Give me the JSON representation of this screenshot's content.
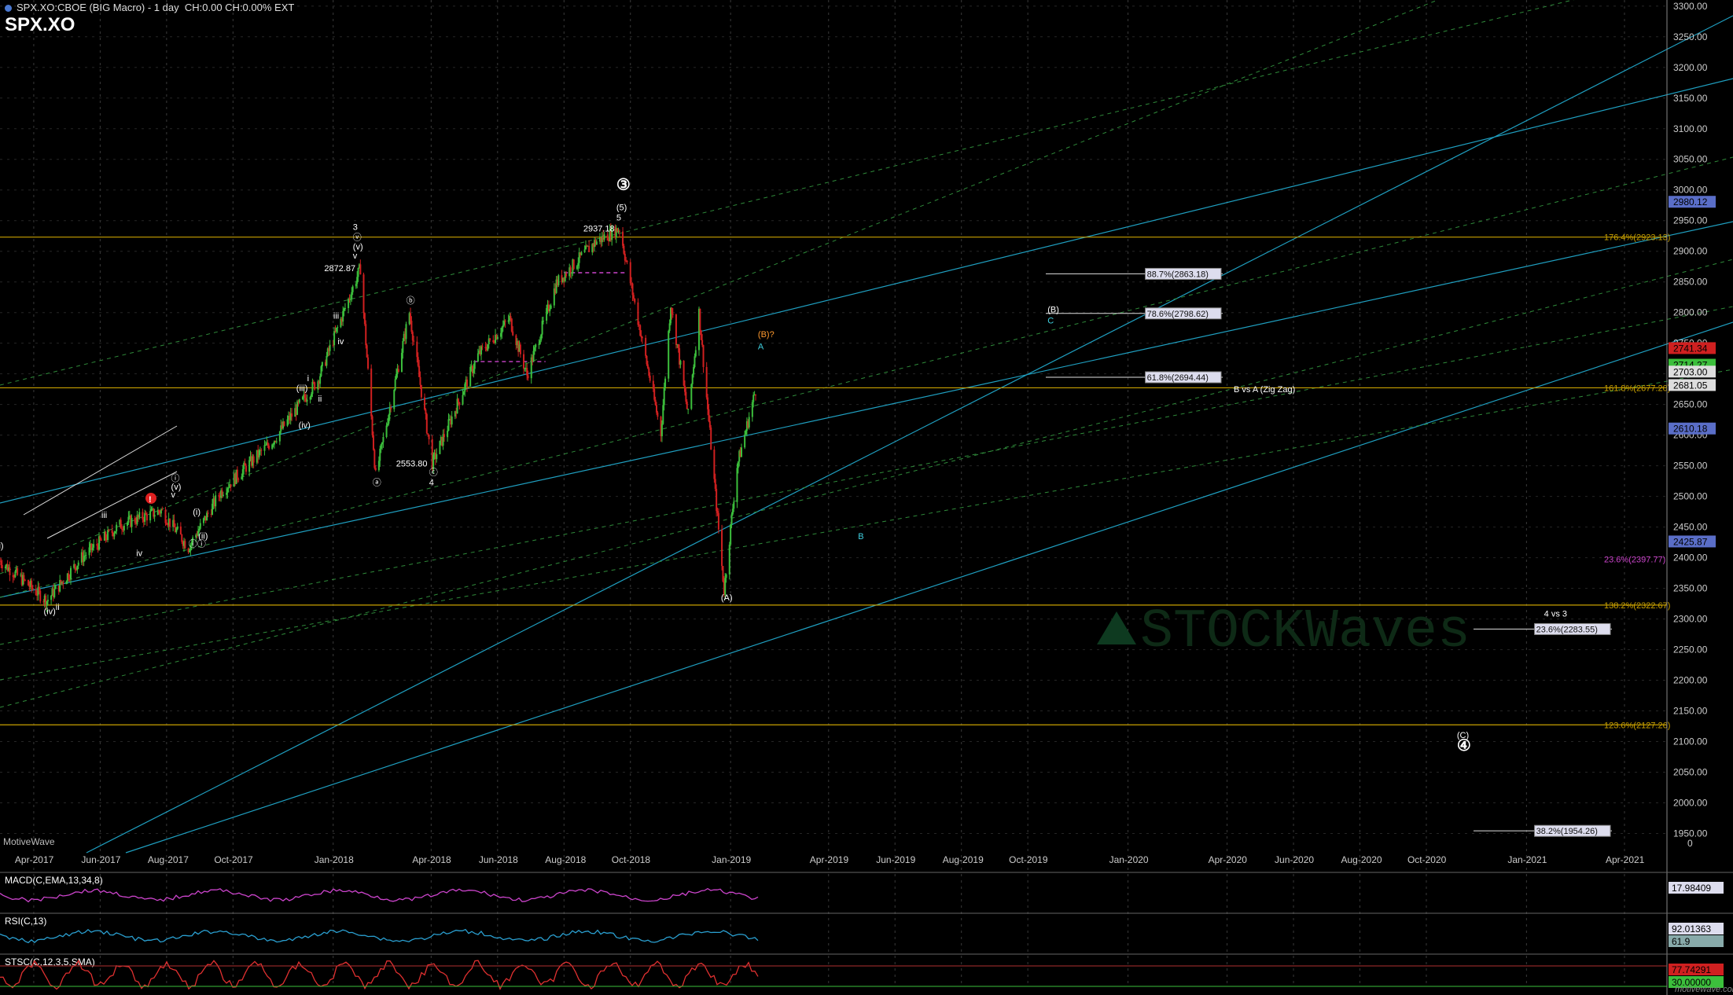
{
  "header": {
    "title": "SPX.XO:CBOE (BIG Macro) - 1 day",
    "stats": "CH:0.00 CH:0.00% EXT",
    "symbol": "SPX.XO"
  },
  "branding": {
    "motivewave_left": "MotiveWave",
    "motivewave_right": "motivewave.com",
    "watermark": "STOCKWaves"
  },
  "colors": {
    "background": "#000000",
    "grid": "#3a3a3a",
    "fib_line": "#c8a000",
    "channel_cyan": "#1f9fc0",
    "channel_green": "#2f8a3a",
    "candle_up": "#3cbf3c",
    "candle_down": "#d02020",
    "magenta": "#cc44cc"
  },
  "chart_data": {
    "type": "candlestick",
    "title": "SPX.XO:CBOE (BIG Macro) - 1 day",
    "ylim": [
      1900,
      3300
    ],
    "y_ticks": [
      1950,
      2000,
      2050,
      2100,
      2150,
      2200,
      2250,
      2300,
      2350,
      2400,
      2450,
      2500,
      2550,
      2600,
      2650,
      2700,
      2750,
      2800,
      2850,
      2900,
      2950,
      3000,
      3050,
      3100,
      3150,
      3200,
      3250,
      3300
    ],
    "x_labels": [
      "Apr-2017",
      "Jun-2017",
      "Aug-2017",
      "Oct-2017",
      "Jan-2018",
      "Apr-2018",
      "Jun-2018",
      "Aug-2018",
      "Oct-2018",
      "Jan-2019",
      "Apr-2019",
      "Jun-2019",
      "Aug-2019",
      "Oct-2019",
      "Jan-2020",
      "Apr-2020",
      "Jun-2020",
      "Aug-2020",
      "Oct-2020",
      "Jan-2021",
      "Apr-2021"
    ],
    "price_path": [
      [
        "2017-03-01",
        2395
      ],
      [
        "2017-04-13",
        2330
      ],
      [
        "2017-05-15",
        2400
      ],
      [
        "2017-06-19",
        2453
      ],
      [
        "2017-07-27",
        2477
      ],
      [
        "2017-08-21",
        2417
      ],
      [
        "2017-09-20",
        2508
      ],
      [
        "2017-11-08",
        2594
      ],
      [
        "2017-12-18",
        2690
      ],
      [
        "2018-01-26",
        2872.87
      ],
      [
        "2018-02-09",
        2532.69
      ],
      [
        "2018-03-12",
        2800
      ],
      [
        "2018-04-02",
        2553.8
      ],
      [
        "2018-05-14",
        2730
      ],
      [
        "2018-06-12",
        2790
      ],
      [
        "2018-06-28",
        2698
      ],
      [
        "2018-07-25",
        2848
      ],
      [
        "2018-08-29",
        2914
      ],
      [
        "2018-09-21",
        2937.18
      ],
      [
        "2018-10-29",
        2603
      ],
      [
        "2018-11-07",
        2815
      ],
      [
        "2018-11-23",
        2632
      ],
      [
        "2018-12-03",
        2800
      ],
      [
        "2018-12-26",
        2346.58
      ],
      [
        "2019-01-07",
        2550
      ],
      [
        "2019-01-25",
        2681.05
      ]
    ],
    "fib_levels": [
      {
        "label": "176.4%(2923.13)",
        "value": 2923.13
      },
      {
        "label": "161.8%(2677.20)",
        "value": 2677.2
      },
      {
        "label": "138.2%(2322.67)",
        "value": 2322.67
      },
      {
        "label": "123.6%(2127.26)",
        "value": 2127.26
      }
    ],
    "fib_lines": [
      {
        "label": "88.7%(2863.18)",
        "value": 2863.18
      },
      {
        "label": "78.6%(2798.62)",
        "value": 2798.62
      },
      {
        "label": "61.8%(2694.44)",
        "value": 2694.44
      },
      {
        "label": "23.6%(2283.55)",
        "value": 2283.55
      },
      {
        "label": "38.2%(1954.26)",
        "value": 1954.26
      }
    ],
    "magenta_level": {
      "label": "23.6%(2397.77)",
      "value": 2397.77
    },
    "price_tags": [
      {
        "label": "2980.12",
        "value": 2980.12,
        "color": "#5a6ec8"
      },
      {
        "label": "2741.34",
        "value": 2741.34,
        "color": "#d02020"
      },
      {
        "label": "2714.27",
        "value": 2714.27,
        "color": "#3cbf3c"
      },
      {
        "label": "2703.00",
        "value": 2703.0,
        "color": "#dddddd"
      },
      {
        "label": "2681.05",
        "value": 2681.05,
        "color": "#dddddd"
      },
      {
        "label": "2610.18",
        "value": 2610.18,
        "color": "#5a6ec8"
      },
      {
        "label": "2425.87",
        "value": 2425.87,
        "color": "#5a6ec8"
      }
    ],
    "price_annotations": [
      {
        "text": "2872.87",
        "date": "2018-01-26",
        "value": 2872.87
      },
      {
        "text": "2553.80",
        "date": "2018-04-02",
        "value": 2553.8
      },
      {
        "text": "2937.18",
        "date": "2018-09-21",
        "value": 2937.18
      }
    ],
    "wave_labels": [
      {
        "text": "ii)",
        "date": "2017-03-01",
        "value": 2415
      },
      {
        "text": "(iv)",
        "date": "2017-04-13",
        "value": 2308
      },
      {
        "text": "ii",
        "date": "2017-04-24",
        "value": 2315
      },
      {
        "text": "iii",
        "date": "2017-06-05",
        "value": 2465
      },
      {
        "text": "iv",
        "date": "2017-07-07",
        "value": 2403
      },
      {
        "text": "v",
        "date": "2017-08-08",
        "value": 2498
      },
      {
        "text": "(v)",
        "date": "2017-08-08",
        "value": 2511
      },
      {
        "text": "ⓘ",
        "date": "2017-08-08",
        "value": 2525
      },
      {
        "text": "(i)",
        "date": "2017-08-28",
        "value": 2470
      },
      {
        "text": "(ii)",
        "date": "2017-09-02",
        "value": 2431
      },
      {
        "text": "ⓘⓘ",
        "date": "2017-08-24",
        "value": 2418
      },
      {
        "text": "(iii)",
        "date": "2017-12-01",
        "value": 2672
      },
      {
        "text": "(iv)",
        "date": "2017-12-03",
        "value": 2612
      },
      {
        "text": "i",
        "date": "2017-12-11",
        "value": 2688
      },
      {
        "text": "ii",
        "date": "2017-12-21",
        "value": 2655
      },
      {
        "text": "iv",
        "date": "2018-01-08",
        "value": 2748
      },
      {
        "text": "iii",
        "date": "2018-01-04",
        "value": 2790
      },
      {
        "text": "v",
        "date": "2018-01-22",
        "value": 2888
      },
      {
        "text": "(v)",
        "date": "2018-01-22",
        "value": 2903
      },
      {
        "text": "ⓥ",
        "date": "2018-01-22",
        "value": 2918
      },
      {
        "text": "3",
        "date": "2018-01-22",
        "value": 2935
      },
      {
        "text": "ⓐ",
        "date": "2018-02-09",
        "value": 2518
      },
      {
        "text": "ⓑ",
        "date": "2018-03-12",
        "value": 2815
      },
      {
        "text": "ⓒ",
        "date": "2018-04-02",
        "value": 2535
      },
      {
        "text": "4",
        "date": "2018-04-02",
        "value": 2518
      },
      {
        "text": "5",
        "date": "2018-09-21",
        "value": 2950
      },
      {
        "text": "(5)",
        "date": "2018-09-21",
        "value": 2967
      },
      {
        "text": "③",
        "date": "2018-09-21",
        "value": 3000
      },
      {
        "text": "(A)",
        "date": "2018-12-26",
        "value": 2330
      },
      {
        "text": "(B)?",
        "date": "2019-01-29",
        "value": 2760
      },
      {
        "text": "A",
        "date": "2019-01-29",
        "value": 2740
      },
      {
        "text": "B",
        "date": "2019-05-01",
        "value": 2430
      },
      {
        "text": "(B)",
        "date": "2019-10-22",
        "value": 2800
      },
      {
        "text": "C",
        "date": "2019-10-22",
        "value": 2782
      },
      {
        "text": "B vs A (Zig Zag)",
        "date": "2020-04-10",
        "value": 2670
      },
      {
        "text": "4 vs 3",
        "date": "2021-01-20",
        "value": 2304
      },
      {
        "text": "(C)",
        "date": "2020-11-01",
        "value": 2106
      },
      {
        "text": "④",
        "date": "2020-11-01",
        "value": 2085
      }
    ],
    "indicators": [
      {
        "name": "MACD(C,EMA,13,34,8)",
        "value": "17.98409"
      },
      {
        "name": "RSI(C,13)",
        "value": "92.01363",
        "secondary": "61.9"
      },
      {
        "name": "STSC(C,12,3,5,SMA)",
        "value": "77.74291",
        "secondary": "30.00000"
      }
    ],
    "grid": true
  }
}
